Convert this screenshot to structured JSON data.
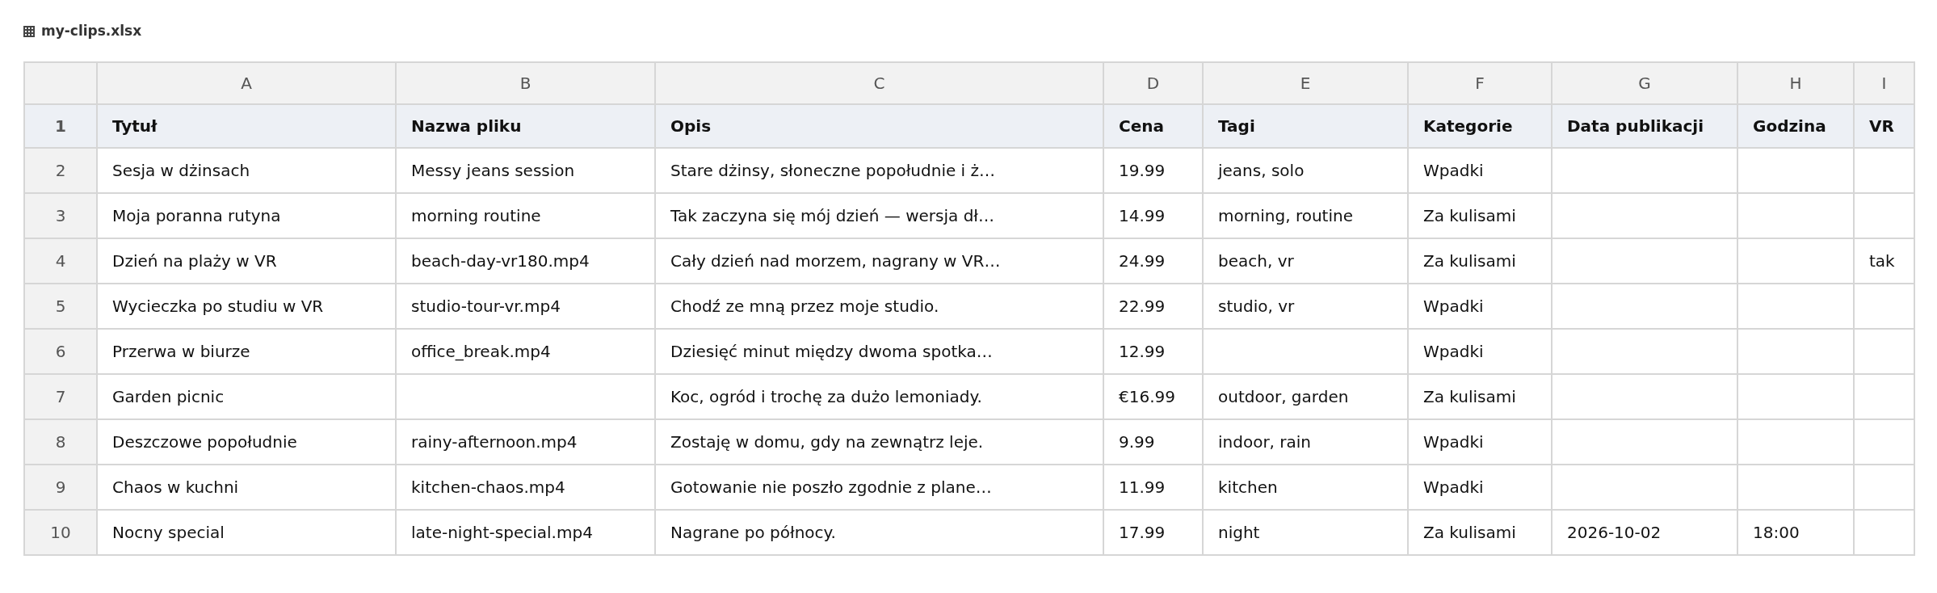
{
  "file": {
    "title": "my-clips.xlsx"
  },
  "sheet": {
    "columns": [
      "A",
      "B",
      "C",
      "D",
      "E",
      "F",
      "G",
      "H",
      "I"
    ],
    "rows": [
      {
        "kind": "header",
        "number": "1",
        "cells": {
          "A": "Tytuł",
          "B": "Nazwa pliku",
          "C": "Opis",
          "D": "Cena",
          "E": "Tagi",
          "F": "Kategorie",
          "G": "Data publikacji",
          "H": "Godzina",
          "I": "VR"
        }
      },
      {
        "kind": "data",
        "number": "2",
        "cells": {
          "A": "Sesja w dżinsach",
          "B": "Messy jeans session",
          "C": "Stare dżinsy, słoneczne popołudnie i ż…",
          "D": "19.99",
          "E": "jeans, solo",
          "F": "Wpadki"
        }
      },
      {
        "kind": "data",
        "number": "3",
        "cells": {
          "A": "Moja poranna rutyna",
          "B": "morning routine",
          "C": "Tak zaczyna się mój dzień — wersja dł…",
          "D": "14.99",
          "E": "morning, routine",
          "F": "Za kulisami"
        }
      },
      {
        "kind": "data",
        "number": "4",
        "cells": {
          "A": "Dzień na plaży w VR",
          "B": "beach-day-vr180.mp4",
          "C": "Cały dzień nad morzem, nagrany w VR…",
          "D": "24.99",
          "E": "beach, vr",
          "F": "Za kulisami",
          "I": "tak"
        }
      },
      {
        "kind": "data",
        "number": "5",
        "cells": {
          "A": "Wycieczka po studiu w VR",
          "B": "studio-tour-vr.mp4",
          "C": "Chodź ze mną przez moje studio.",
          "D": "22.99",
          "E": "studio, vr",
          "F": "Wpadki"
        }
      },
      {
        "kind": "data",
        "number": "6",
        "cells": {
          "A": "Przerwa w biurze",
          "B": "office_break.mp4",
          "C": "Dziesięć minut między dwoma spotka…",
          "D": "12.99",
          "F": "Wpadki"
        }
      },
      {
        "kind": "data",
        "number": "7",
        "cells": {
          "A": "Garden picnic",
          "C": "Koc, ogród i trochę za dużo lemoniady.",
          "D": "€16.99",
          "E": "outdoor, garden",
          "F": "Za kulisami"
        }
      },
      {
        "kind": "data",
        "number": "8",
        "cells": {
          "A": "Deszczowe popołudnie",
          "B": "rainy-afternoon.mp4",
          "C": "Zostaję w domu, gdy na zewnątrz leje.",
          "D": "9.99",
          "E": "indoor, rain",
          "F": "Wpadki"
        }
      },
      {
        "kind": "data",
        "number": "9",
        "cells": {
          "A": "Chaos w kuchni",
          "B": "kitchen-chaos.mp4",
          "C": "Gotowanie nie poszło zgodnie z plane…",
          "D": "11.99",
          "E": "kitchen",
          "F": "Wpadki"
        }
      },
      {
        "kind": "data",
        "number": "10",
        "cells": {
          "A": "Nocny special",
          "B": "late-night-special.mp4",
          "C": "Nagrane po północy.",
          "D": "17.99",
          "E": "night",
          "F": "Za kulisami",
          "G": "2026-10-02",
          "H": "18:00"
        }
      }
    ]
  }
}
